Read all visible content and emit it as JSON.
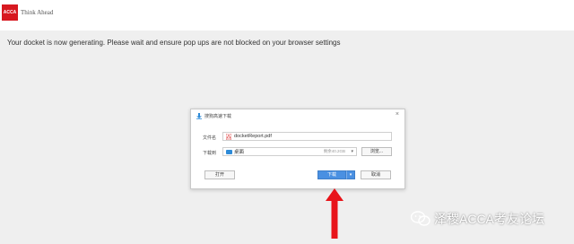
{
  "header": {
    "logo_text": "ACCA",
    "tagline": "Think Ahead"
  },
  "status_message": "Your docket is now generating. Please wait and ensure pop ups are not blocked on your browser settings",
  "dialog": {
    "title": "搜狗高速下载",
    "filename_label": "文件名",
    "filename_value": "docketReport.pdf",
    "saveto_label": "下载到",
    "saveto_value": "桌面",
    "free_space": "剩余40.2GB",
    "browse_label": "浏览...",
    "open_label": "打开",
    "download_label": "下载",
    "cancel_label": "取消"
  },
  "watermark": {
    "text": "泽稷ACCA考友论坛"
  },
  "colors": {
    "brand_red": "#d71920",
    "primary_button": "#4a90e2",
    "arrow": "#e8141a"
  }
}
